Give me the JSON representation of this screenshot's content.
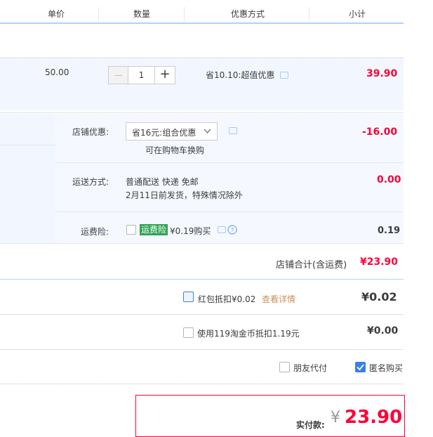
{
  "header": {
    "unit_price": "单价",
    "quantity": "数量",
    "discount_method": "优惠方式",
    "subtotal": "小计"
  },
  "item": {
    "unit_price": "50.00",
    "quantity": "1",
    "minus": "—",
    "plus": "+",
    "promo": "省10.10:超值优惠",
    "subtotal": "39.90"
  },
  "shop": {
    "discount_label": "店铺优惠:",
    "discount_select": "省16元:组合优惠",
    "discount_note": "可在购物车换购",
    "discount_value": "-16.00",
    "shipping_label": "运送方式:",
    "shipping_method": "普通配送 快递 免邮",
    "shipping_note": "2月11日前发货，特殊情况除外",
    "shipping_value": "0.00",
    "insurance_label": "运费险:",
    "insurance_tag": "运费险",
    "insurance_price": "¥0.19购买",
    "insurance_value": "0.19",
    "total_label": "店铺合计(含运费)",
    "total_value": "¥23.90"
  },
  "redpacket": {
    "label": "红包抵扣¥0.02",
    "link": "查看详情",
    "value": "¥0.02"
  },
  "coins": {
    "label": "使用119淘金币抵扣1.19元",
    "value": "¥0.00"
  },
  "options": {
    "friend_pay": "朋友代付",
    "anonymous": "匿名购买"
  },
  "payment": {
    "label": "实付款:",
    "currency": "¥",
    "amount": "23.90"
  },
  "colors": {
    "accent_red": "#ff0036",
    "light_blue_bg": "#f2f7ff",
    "header_border": "#b2d1ff",
    "checkbox_blue": "#3b7fe6",
    "insurance_tag_bg": "#31a355",
    "link_orange": "#c9915a"
  }
}
